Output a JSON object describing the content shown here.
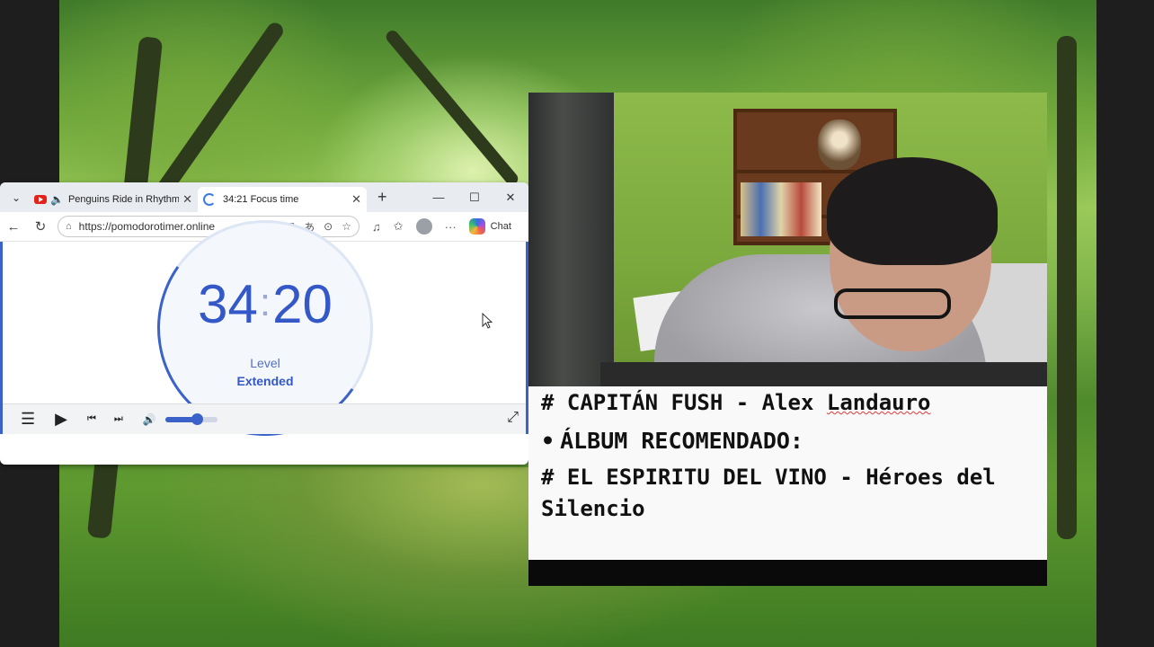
{
  "browser": {
    "tabs": [
      {
        "title": "Penguins Ride in Rhythm",
        "active": false,
        "icon": "youtube-icon",
        "audio": true
      },
      {
        "title": "34:21 Focus time",
        "active": true,
        "icon": "loading-icon"
      }
    ],
    "new_tab": "+",
    "window_controls": {
      "minimize": "—",
      "maximize": "☐",
      "close": "✕"
    },
    "url": "https://pomodorotimer.online",
    "chat_label": "Chat"
  },
  "timer": {
    "minutes": "34",
    "seconds": "20",
    "level_label": "Level",
    "level_value": "Extended"
  },
  "player": {
    "volume_level": 0.6
  },
  "notes": {
    "line1_prefix": "# CAPITÁN FUSH - Alex ",
    "line1_word": "Landauro",
    "line2": "ÁLBUM RECOMENDADO:",
    "line3": "# EL ESPIRITU DEL VINO - Héroes del Silencio"
  },
  "colors": {
    "accent": "#3a62c9",
    "timer_text": "#3458c8"
  }
}
